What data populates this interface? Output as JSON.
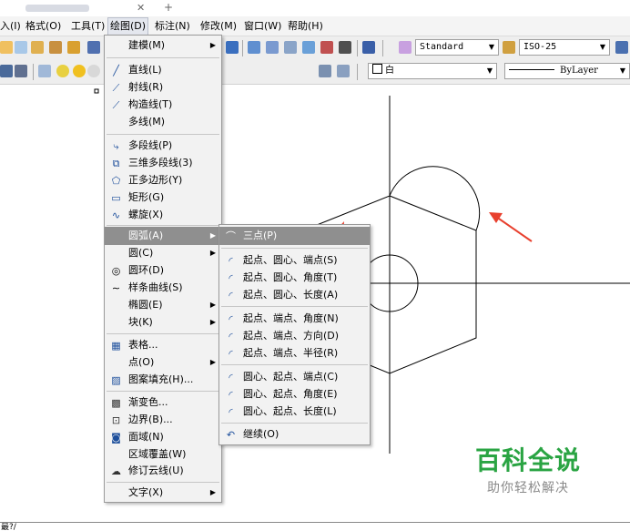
{
  "menubar": {
    "items": [
      "入(I)",
      "格式(O)",
      "工具(T)",
      "绘图(D)",
      "标注(N)",
      "修改(M)",
      "窗口(W)",
      "帮助(H)"
    ]
  },
  "toolbar": {
    "text_style": "Standard",
    "dim_style": "ISO-25",
    "color": "白",
    "linetype": "ByLayer"
  },
  "draw_menu": {
    "items": [
      {
        "label": "建模(M)",
        "icon": "",
        "submenu": true
      },
      {
        "label": "直线(L)",
        "icon": "line-icon"
      },
      {
        "label": "射线(R)",
        "icon": "ray-icon"
      },
      {
        "label": "构造线(T)",
        "icon": "xline-icon"
      },
      {
        "label": "多线(M)",
        "icon": ""
      },
      {
        "label": "多段线(P)",
        "icon": "polyline-icon"
      },
      {
        "label": "三维多段线(3)",
        "icon": "3d-polyline-icon"
      },
      {
        "label": "正多边形(Y)",
        "icon": "polygon-icon"
      },
      {
        "label": "矩形(G)",
        "icon": "rectangle-icon"
      },
      {
        "label": "螺旋(X)",
        "icon": "helix-icon"
      },
      {
        "label": "圆弧(A)",
        "icon": "",
        "submenu": true,
        "highlighted": true
      },
      {
        "label": "圆(C)",
        "icon": "",
        "submenu": true
      },
      {
        "label": "圆环(D)",
        "icon": "donut-icon"
      },
      {
        "label": "样条曲线(S)",
        "icon": "spline-icon"
      },
      {
        "label": "椭圆(E)",
        "icon": "",
        "submenu": true
      },
      {
        "label": "块(K)",
        "icon": "",
        "submenu": true
      },
      {
        "label": "表格...",
        "icon": "table-icon"
      },
      {
        "label": "点(O)",
        "icon": "",
        "submenu": true
      },
      {
        "label": "图案填充(H)...",
        "icon": "hatch-icon"
      },
      {
        "label": "渐变色...",
        "icon": "gradient-icon"
      },
      {
        "label": "边界(B)...",
        "icon": "boundary-icon"
      },
      {
        "label": "面域(N)",
        "icon": "region-icon"
      },
      {
        "label": "区域覆盖(W)",
        "icon": ""
      },
      {
        "label": "修订云线(U)",
        "icon": "revcloud-icon"
      },
      {
        "label": "文字(X)",
        "icon": "",
        "submenu": true
      }
    ]
  },
  "arc_menu": {
    "items": [
      {
        "label": "三点(P)",
        "highlighted": true
      },
      {
        "label": "起点、圆心、端点(S)"
      },
      {
        "label": "起点、圆心、角度(T)"
      },
      {
        "label": "起点、圆心、长度(A)"
      },
      {
        "label": "起点、端点、角度(N)"
      },
      {
        "label": "起点、端点、方向(D)"
      },
      {
        "label": "起点、端点、半径(R)"
      },
      {
        "label": "圆心、起点、端点(C)"
      },
      {
        "label": "圆心、起点、角度(E)"
      },
      {
        "label": "圆心、起点、长度(L)"
      },
      {
        "label": "继续(O)"
      }
    ]
  },
  "command_line": "最?/",
  "watermark": {
    "title": "百科全说",
    "subtitle": "助你轻松解决"
  },
  "colors": {
    "menu_bg": "#f2f2f2",
    "highlight": "#8f8f8f",
    "arrow": "#e8402e",
    "watermark_green": "#2aa443"
  }
}
